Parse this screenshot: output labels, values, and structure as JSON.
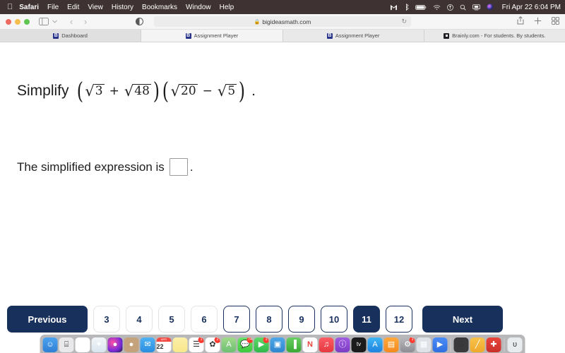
{
  "menubar": {
    "apple_icon": "apple-icon",
    "items": [
      {
        "label": "Safari",
        "bold": true
      },
      {
        "label": "File",
        "bold": false
      },
      {
        "label": "Edit",
        "bold": false
      },
      {
        "label": "View",
        "bold": false
      },
      {
        "label": "History",
        "bold": false
      },
      {
        "label": "Bookmarks",
        "bold": false
      },
      {
        "label": "Window",
        "bold": false
      },
      {
        "label": "Help",
        "bold": false
      }
    ],
    "status_icons": [
      "gmail-icon",
      "bluetooth-icon",
      "battery-icon",
      "wifi-icon",
      "control-center-icon",
      "spotlight-search-icon",
      "screen-mirroring-icon",
      "siri-icon"
    ],
    "clock": "Fri Apr 22  6:04 PM"
  },
  "browser": {
    "traffic_lights": [
      "close-button",
      "minimize-button",
      "zoom-button"
    ],
    "sidebar_icon": "sidebar-toggle-icon",
    "back_icon": "‹",
    "forward_icon": "›",
    "reader_icon": "reader-view-icon",
    "address": {
      "lock_icon": "🔒",
      "url": "bigideasmath.com",
      "reload_icon": "↻"
    },
    "right_icons": [
      "share-icon",
      "new-tab-icon",
      "tab-overview-icon"
    ],
    "tabs": [
      {
        "title": "Dashboard",
        "favicon": "bigideasmath-b-icon",
        "state": "inactive-dim"
      },
      {
        "title": "Assignment Player",
        "favicon": "bigideasmath-b-icon",
        "state": "active"
      },
      {
        "title": "Assignment Player",
        "favicon": "bigideasmath-b-icon",
        "state": "inactive"
      },
      {
        "title": "Brainly.com - For students. By students.",
        "favicon": "brainly-icon",
        "state": "inactive"
      }
    ]
  },
  "content": {
    "question": {
      "label": "Simplify",
      "expression_plain": "(√3 + √48)(√20 − √5).",
      "group1": {
        "radical1": {
          "radicand": "3"
        },
        "operator": "+",
        "radical2": {
          "radicand": "48"
        }
      },
      "group2": {
        "radical1": {
          "radicand": "20"
        },
        "operator": "−",
        "radical2": {
          "radicand": "5"
        }
      },
      "radical_glyph": "√",
      "open_paren": "(",
      "close_paren": ")",
      "period": "."
    },
    "answer": {
      "prefix": "The simplified expression is",
      "input_value": "",
      "input_placeholder": "",
      "suffix": "."
    }
  },
  "navigation": {
    "previous_label": "Previous",
    "next_label": "Next",
    "pages": [
      {
        "label": "3",
        "state": "unvisited"
      },
      {
        "label": "4",
        "state": "unvisited"
      },
      {
        "label": "5",
        "state": "unvisited"
      },
      {
        "label": "6",
        "state": "unvisited"
      },
      {
        "label": "7",
        "state": "visited"
      },
      {
        "label": "8",
        "state": "visited"
      },
      {
        "label": "9",
        "state": "visited"
      },
      {
        "label": "10",
        "state": "visited"
      },
      {
        "label": "11",
        "state": "current"
      },
      {
        "label": "12",
        "state": "visited"
      }
    ],
    "current_page": "11",
    "accent_color": "#18305c"
  },
  "dock": {
    "items": [
      {
        "name": "finder-icon",
        "glyph": "☺",
        "bg": "linear-gradient(180deg,#4ba3f0,#2f7fd4)",
        "badge": "",
        "running": true
      },
      {
        "name": "launchpad-icon",
        "glyph": "⌸",
        "bg": "#e9e9ec",
        "badge": "",
        "running": false
      },
      {
        "name": "chrome-icon",
        "glyph": "◉",
        "bg": "#ffffff",
        "badge": "",
        "running": true
      },
      {
        "name": "safari-icon",
        "glyph": "✦",
        "bg": "linear-gradient(180deg,#f3f6f9,#d9e4ee)",
        "badge": "",
        "running": true
      },
      {
        "name": "siri-icon",
        "glyph": "●",
        "bg": "radial-gradient(circle at 35% 35%,#ff4fa3,#7a2bd8 60%,#1b1b3a)",
        "badge": "",
        "running": false
      },
      {
        "name": "contacts-icon",
        "glyph": "●",
        "bg": "#c4a37c",
        "badge": "",
        "running": false
      },
      {
        "name": "mail-icon",
        "glyph": "✉",
        "bg": "linear-gradient(180deg,#4eb3f5,#2a8de0)",
        "badge": "",
        "running": false
      },
      {
        "name": "calendar-icon",
        "glyph": "22",
        "bg": "#ffffff",
        "badge": "",
        "running": false
      },
      {
        "name": "notes-icon",
        "glyph": "",
        "bg": "linear-gradient(180deg,#fdf0a8,#f7e78a)",
        "badge": "",
        "running": false
      },
      {
        "name": "reminders-icon",
        "glyph": "☰",
        "bg": "#ffffff",
        "badge": "1",
        "running": false
      },
      {
        "name": "photos-icon",
        "glyph": "✿",
        "bg": "#ffffff",
        "badge": "2",
        "running": false
      },
      {
        "name": "maps-icon",
        "glyph": "A",
        "bg": "linear-gradient(180deg,#9fd98a,#6fbf73)",
        "badge": "",
        "running": false
      },
      {
        "name": "messages-icon",
        "glyph": "💬",
        "bg": "linear-gradient(180deg,#6ce26c,#3cc93c)",
        "badge": "74",
        "running": false
      },
      {
        "name": "facetime-icon",
        "glyph": "▶",
        "bg": "linear-gradient(180deg,#5fd96a,#2fb94a)",
        "badge": "1",
        "running": false
      },
      {
        "name": "keynote-icon",
        "glyph": "▣",
        "bg": "linear-gradient(180deg,#4ea8e8,#2f86cf)",
        "badge": "",
        "running": false
      },
      {
        "name": "numbers-icon",
        "glyph": "▐",
        "bg": "linear-gradient(180deg,#68cf62,#3aa832)",
        "badge": "",
        "running": false
      },
      {
        "name": "news-icon",
        "glyph": "N",
        "bg": "#ffffff",
        "badge": "",
        "running": false
      },
      {
        "name": "music-icon",
        "glyph": "♫",
        "bg": "linear-gradient(180deg,#fc5c65,#e5383f)",
        "badge": "",
        "running": false
      },
      {
        "name": "podcasts-icon",
        "glyph": "ⓘ",
        "bg": "linear-gradient(180deg,#a05ce0,#7c3cc4)",
        "badge": "",
        "running": false
      },
      {
        "name": "apple-tv-icon",
        "glyph": "tv",
        "bg": "#1b1b1b",
        "badge": "",
        "running": false
      },
      {
        "name": "app-store-icon",
        "glyph": "A",
        "bg": "linear-gradient(180deg,#3fb6f5,#1f82e0)",
        "badge": "",
        "running": false
      },
      {
        "name": "books-icon",
        "glyph": "▤",
        "bg": "linear-gradient(180deg,#ffa83c,#f48a1e)",
        "badge": "",
        "running": false
      },
      {
        "name": "system-preferences-icon",
        "glyph": "⚙",
        "bg": "linear-gradient(180deg,#b9b9bd,#8d8d93)",
        "badge": "1",
        "running": false
      },
      {
        "name": "screenshot-app-icon",
        "glyph": "▦",
        "bg": "#dfe3e8",
        "badge": "",
        "running": false
      },
      {
        "name": "zoom-app-icon",
        "glyph": "▶",
        "bg": "linear-gradient(180deg,#4a8cf7,#2f6fe0)",
        "badge": "",
        "running": false
      },
      {
        "name": "calculator-icon",
        "glyph": "⌸",
        "bg": "#3a3a3c",
        "badge": "",
        "running": false
      },
      {
        "name": "text-edit-icon",
        "glyph": "╱",
        "bg": "linear-gradient(180deg,#f7c24a,#efa92c)",
        "badge": "",
        "running": false
      },
      {
        "name": "first-aid-app-icon",
        "glyph": "✚",
        "bg": "linear-gradient(180deg,#e8453c,#c9302a)",
        "badge": "",
        "running": false
      },
      {
        "name": "trash-icon",
        "glyph": "ᴜ",
        "bg": "#e9ecef",
        "badge": "",
        "running": false
      }
    ],
    "separator_positions": [
      25,
      28
    ]
  }
}
